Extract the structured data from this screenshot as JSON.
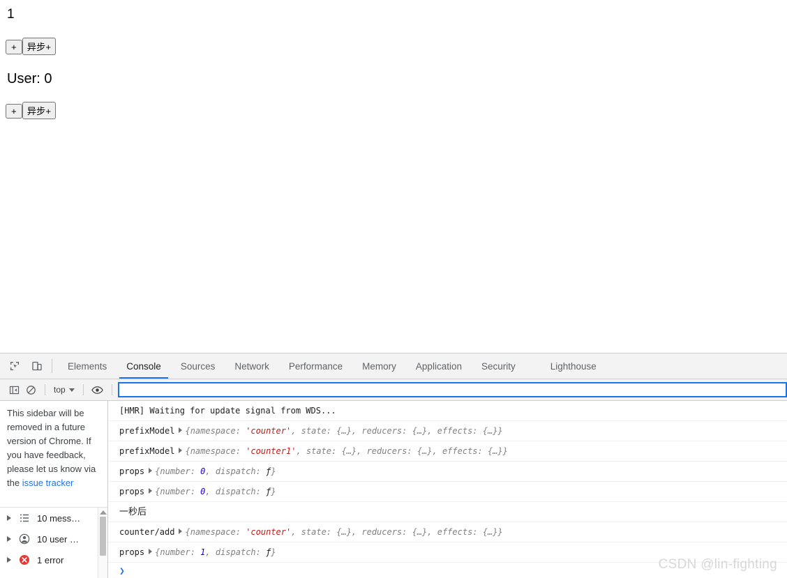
{
  "page": {
    "counter_value": "1",
    "user_label": "User: 0",
    "buttons": {
      "plus": "+",
      "async_plus": "异步+"
    }
  },
  "devtools": {
    "toolbar_icons": [
      {
        "name": "inspect-element-icon",
        "title": "Inspect element"
      },
      {
        "name": "device-toolbar-icon",
        "title": "Toggle device toolbar"
      }
    ],
    "tabs": [
      {
        "label": "Elements",
        "active": false
      },
      {
        "label": "Console",
        "active": true
      },
      {
        "label": "Sources",
        "active": false
      },
      {
        "label": "Network",
        "active": false
      },
      {
        "label": "Performance",
        "active": false
      },
      {
        "label": "Memory",
        "active": false
      },
      {
        "label": "Application",
        "active": false
      },
      {
        "label": "Security",
        "active": false
      },
      {
        "label": "Lighthouse",
        "active": false
      }
    ],
    "console_toolbar": {
      "sidebar_toggle": "console-sidebar-toggle-icon",
      "clear_console": "clear-console-icon",
      "context_label": "top",
      "eye_icon": "live-expression-eye-icon",
      "filter_value": "",
      "filter_placeholder": ""
    },
    "sidebar": {
      "notice_text": "This sidebar will be removed in a future version of Chrome. If you have feedback, please let us know via the ",
      "notice_link": "issue tracker",
      "entries": [
        {
          "icon": "list-icon",
          "label": "10 mess…"
        },
        {
          "icon": "user-icon",
          "label": "10 user …"
        },
        {
          "icon": "error-icon",
          "label": "1 error"
        }
      ]
    },
    "messages": [
      {
        "kind": "plain",
        "text": "[HMR] Waiting for update signal from WDS..."
      },
      {
        "kind": "object",
        "label": "prefixModel",
        "parts": [
          {
            "t": "p",
            "v": "{namespace: "
          },
          {
            "t": "str",
            "v": "'counter'"
          },
          {
            "t": "p",
            "v": ", state: {…}, reducers: {…}, effects: {…}}"
          }
        ]
      },
      {
        "kind": "object",
        "label": "prefixModel",
        "parts": [
          {
            "t": "p",
            "v": "{namespace: "
          },
          {
            "t": "str",
            "v": "'counter1'"
          },
          {
            "t": "p",
            "v": ", state: {…}, reducers: {…}, effects: {…}}"
          }
        ]
      },
      {
        "kind": "object",
        "label": "props",
        "parts": [
          {
            "t": "p",
            "v": "{number: "
          },
          {
            "t": "num",
            "v": "0"
          },
          {
            "t": "p",
            "v": ", dispatch: "
          },
          {
            "t": "fn",
            "v": "ƒ"
          },
          {
            "t": "p",
            "v": "}"
          }
        ]
      },
      {
        "kind": "object",
        "label": "props",
        "parts": [
          {
            "t": "p",
            "v": "{number: "
          },
          {
            "t": "num",
            "v": "0"
          },
          {
            "t": "p",
            "v": ", dispatch: "
          },
          {
            "t": "fn",
            "v": "ƒ"
          },
          {
            "t": "p",
            "v": "}"
          }
        ]
      },
      {
        "kind": "cjk",
        "text": "一秒后"
      },
      {
        "kind": "object",
        "label": "counter/add",
        "parts": [
          {
            "t": "p",
            "v": "{namespace: "
          },
          {
            "t": "str",
            "v": "'counter'"
          },
          {
            "t": "p",
            "v": ", state: {…}, reducers: {…}, effects: {…}}"
          }
        ]
      },
      {
        "kind": "object",
        "label": "props",
        "parts": [
          {
            "t": "p",
            "v": "{number: "
          },
          {
            "t": "num",
            "v": "1"
          },
          {
            "t": "p",
            "v": ", dispatch: "
          },
          {
            "t": "fn",
            "v": "ƒ"
          },
          {
            "t": "p",
            "v": "}"
          }
        ]
      }
    ],
    "prompt_chevron": "›"
  },
  "watermark": "CSDN @lin-fighting",
  "colors": {
    "accent": "#1a73e8",
    "string": "#c41a16",
    "number": "#1c00cf",
    "object": "#808080",
    "error": "#e53935",
    "toolbar_bg": "#f3f3f3",
    "border": "#cdcdcd"
  }
}
